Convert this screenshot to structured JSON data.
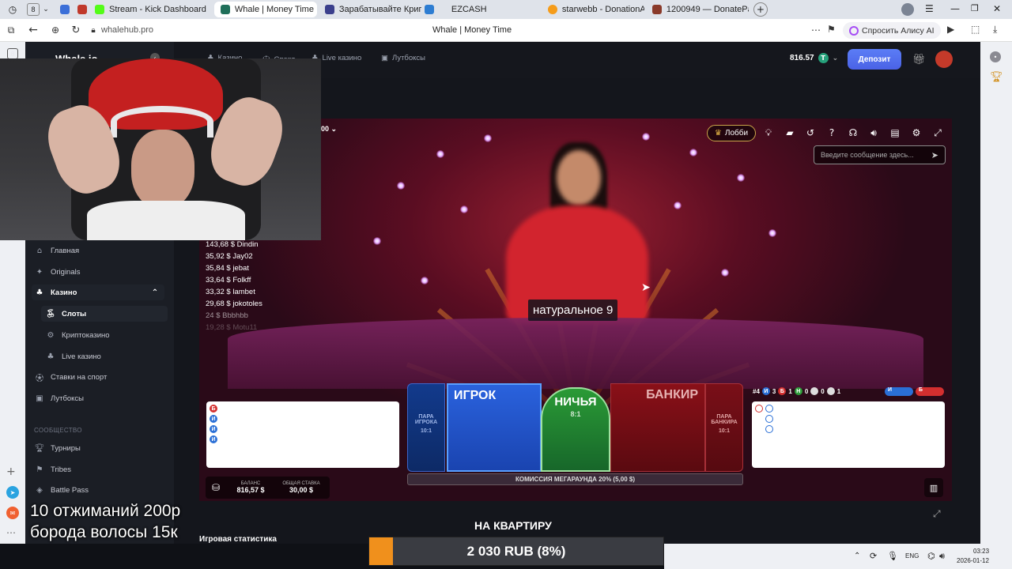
{
  "browser": {
    "tab_count": "8",
    "tabs": [
      {
        "label": "Stream - Kick Dashboard",
        "color": "#53fc18"
      },
      {
        "label": "Whale | Money Time",
        "color": "#1f6f5a",
        "active": true
      },
      {
        "label": "Зарабатывайте Крипту - I",
        "color": "#3b3f8c"
      },
      {
        "label": "EZCASH",
        "color": "#2d7dd2"
      },
      {
        "label": "starwebb - DonationAlert",
        "color": "#f59c1a"
      },
      {
        "label": "1200949 — DonatePay",
        "color": "#8a3a2a"
      }
    ],
    "url": "whalehub.pro",
    "page_title": "Whale | Money Time",
    "alice_label": "Спросить Алису AI"
  },
  "site": {
    "logo": "Whale.io",
    "nav": {
      "casino": "Казино",
      "sport": "Спорт",
      "live": "Live казино",
      "lootboxes": "Лутбоксы"
    },
    "balance": "816.57",
    "deposit_label": "Депозит",
    "sidebar": {
      "main": "Главная",
      "originals": "Originals",
      "casino": "Казино",
      "slots": "Слоты",
      "crypto": "Криптоказино",
      "live": "Live казино",
      "sport": "Ставки на спорт",
      "lootboxes": "Лутбоксы",
      "community_header": "СООБЩЕСТВО",
      "tournaments": "Турниры",
      "tribes": "Tribes",
      "battle_pass": "Battle Pass"
    },
    "stats_title": "Игровая статистика",
    "apartment_label": "НА КВАРТИРУ"
  },
  "game": {
    "bet_level": "00",
    "lobby_label": "Лобби",
    "chat_placeholder": "Введите сообщение здесь...",
    "result_text": "натуральное 9",
    "winners": [
      "143,68 $ Dindin",
      "35,92 $ Jay02",
      "35,84 $ jebat",
      "33,64 $ Folkff",
      "33,32 $ lambet",
      "29,68 $ jokotoles",
      "24 $ Bbbhbb",
      "19,28 $ Motu11"
    ],
    "left_road": [
      "Б",
      "И",
      "И",
      "И"
    ],
    "stats_row": {
      "round": "#4",
      "player_count": "3",
      "banker_count": "1",
      "tie_count": "0",
      "player_pair": "0",
      "banker_pair": "1"
    },
    "bet_zones": {
      "player_pair": "ПАРА ИГРОКА",
      "player_pair_odds": "10:1",
      "player": "ИГРОК",
      "tie": "НИЧЬЯ",
      "tie_odds": "8:1",
      "banker": "БАНКИР",
      "banker_pair": "ПАРА БАНКИРА",
      "banker_pair_odds": "10:1"
    },
    "commission": "КОМИССИЯ МЕГАРАУНДА 20% (5,00 $)",
    "balance_label": "БАЛАНС",
    "balance_value": "816,57 $",
    "total_bet_label": "ОБЩАЯ СТАВКА",
    "total_bet_value": "30,00 $"
  },
  "overlay": {
    "challenge_line1": "10 отжиманий 200р",
    "challenge_line2": "борода волосы 15к",
    "goal_text": "2 030 RUB (8%)",
    "goal_progress": 0.08
  },
  "taskbar": {
    "lang": "ENG",
    "time": "03:23",
    "date": "2026-01-12"
  },
  "colors": {
    "accent": "#4a62e6",
    "player": "#2457d6",
    "banker": "#a0141c",
    "tie": "#1f8a2e",
    "goal": "#f0901c"
  }
}
